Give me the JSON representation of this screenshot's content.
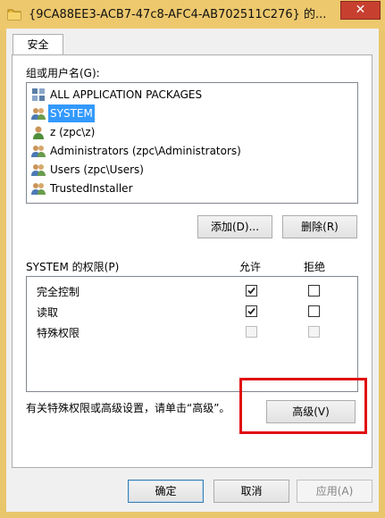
{
  "window": {
    "title": "{9CA88EE3-ACB7-47c8-AFC4-AB702511C276} 的...",
    "close_glyph": "✕",
    "title_icon": "folder-icon"
  },
  "tabs": [
    {
      "label": "安全"
    }
  ],
  "groups": {
    "label": "组或用户名(G):",
    "items": [
      {
        "name": "ALL APPLICATION PACKAGES",
        "icon": "app-packages-icon",
        "selected": false
      },
      {
        "name": "SYSTEM",
        "icon": "users-group-icon",
        "selected": true
      },
      {
        "name": "z (zpc\\z)",
        "icon": "user-icon",
        "selected": false
      },
      {
        "name": "Administrators (zpc\\Administrators)",
        "icon": "users-group-icon",
        "selected": false
      },
      {
        "name": "Users (zpc\\Users)",
        "icon": "users-group-icon",
        "selected": false
      },
      {
        "name": "TrustedInstaller",
        "icon": "users-group-icon",
        "selected": false
      }
    ]
  },
  "buttons": {
    "add": "添加(D)...",
    "remove": "删除(R)",
    "advanced": "高级(V)",
    "ok": "确定",
    "cancel": "取消",
    "apply": "应用(A)"
  },
  "permissions": {
    "label": "SYSTEM 的权限(P)",
    "allow_header": "允许",
    "deny_header": "拒绝",
    "rows": [
      {
        "name": "完全控制",
        "allow": true,
        "deny": false,
        "enabled": true
      },
      {
        "name": "读取",
        "allow": true,
        "deny": false,
        "enabled": true
      },
      {
        "name": "特殊权限",
        "allow": false,
        "deny": false,
        "enabled": false
      }
    ]
  },
  "advanced_hint": "有关特殊权限或高级设置，请单击“高级”。",
  "colors": {
    "selection": "#3399ff",
    "highlight_box": "#e01010",
    "title_bar": "#edc86d"
  }
}
